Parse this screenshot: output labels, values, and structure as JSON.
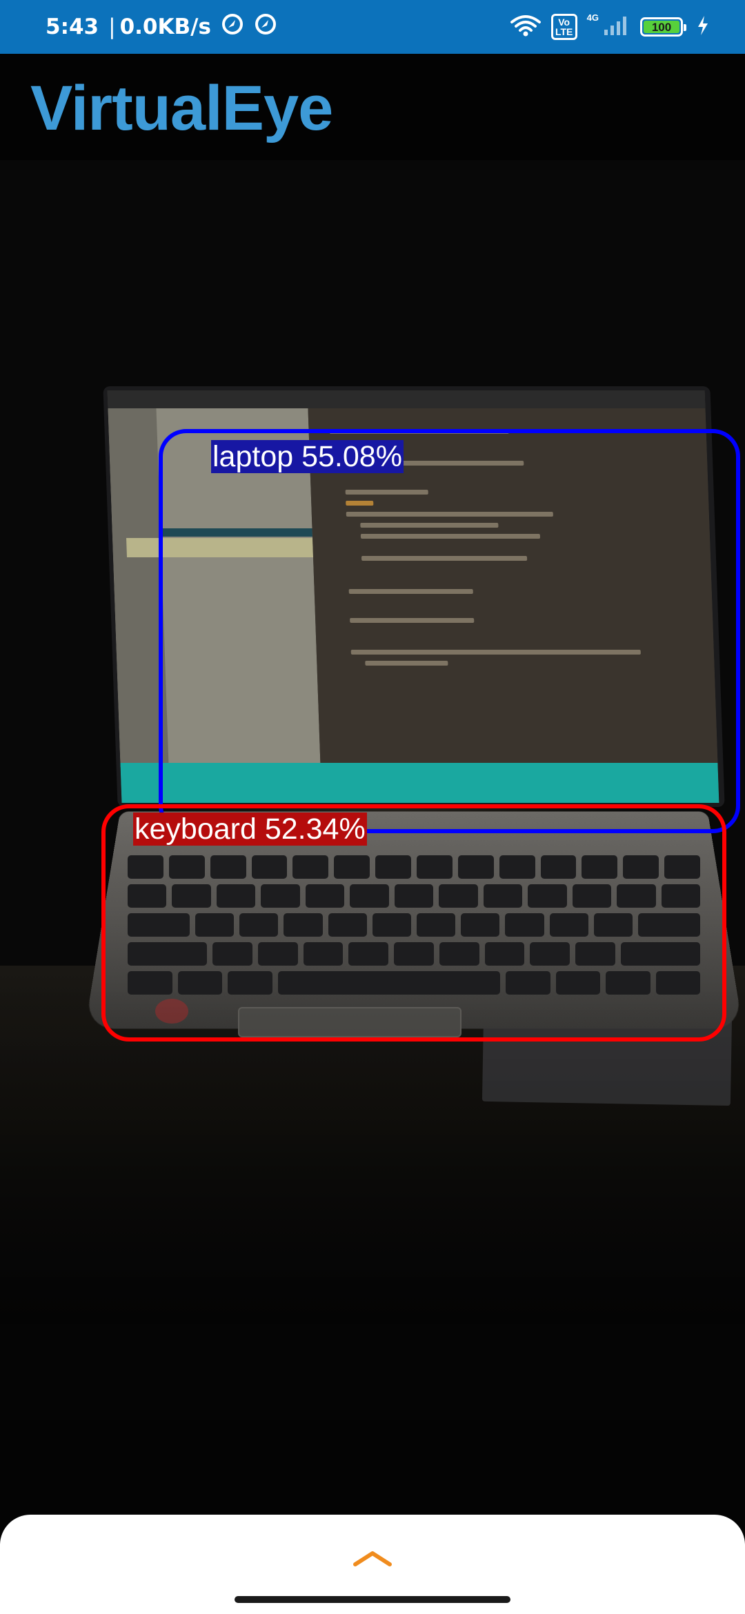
{
  "status_bar": {
    "time": "5:43",
    "separator": "|",
    "net_speed": "0.0KB/s",
    "volte_label": "Vo LTE",
    "network_type": "4G",
    "battery_level": "100",
    "icons": [
      "location-icon",
      "location-icon",
      "wifi-icon",
      "signal-icon",
      "charging-icon"
    ]
  },
  "app": {
    "title": "VirtualEye",
    "title_color": "#3d9ad7"
  },
  "detections": [
    {
      "label": "laptop 55.08%",
      "class": "laptop",
      "confidence": 55.08,
      "color": "#0000ff"
    },
    {
      "label": "keyboard 52.34%",
      "class": "keyboard",
      "confidence": 52.34,
      "color": "#ff0000"
    }
  ],
  "bottom_sheet": {
    "handle_icon": "chevron-up-icon",
    "accent": "#f08c1e"
  }
}
